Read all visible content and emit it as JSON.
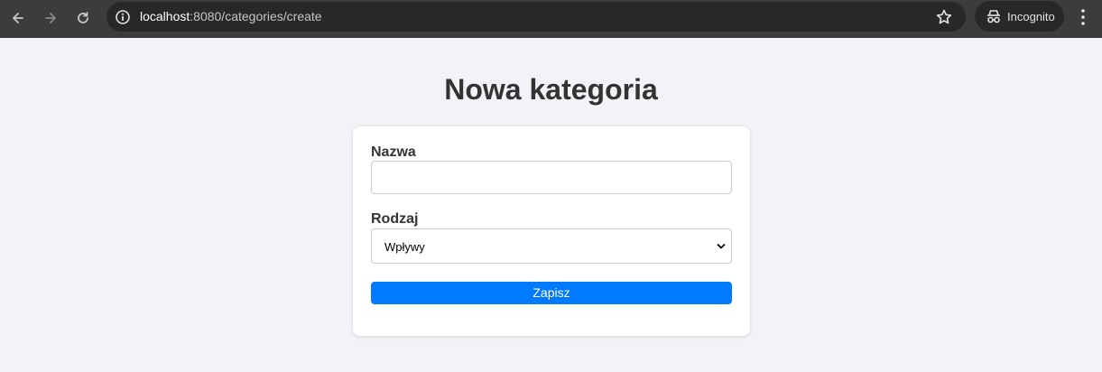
{
  "browser": {
    "url_host": "localhost",
    "url_path": ":8080/categories/create",
    "incognito_label": "Incognito"
  },
  "page": {
    "title": "Nowa kategoria"
  },
  "form": {
    "name_label": "Nazwa",
    "name_value": "",
    "type_label": "Rodzaj",
    "type_selected": "Wpływy",
    "submit_label": "Zapisz"
  },
  "colors": {
    "primary_button": "#007bff",
    "page_background": "#f3f2f7",
    "toolbar_background": "#3c3c3c"
  },
  "icons": [
    "back-arrow-icon",
    "forward-arrow-icon",
    "reload-icon",
    "info-icon",
    "star-icon",
    "incognito-icon",
    "more-vert-icon",
    "chevron-down-icon"
  ]
}
